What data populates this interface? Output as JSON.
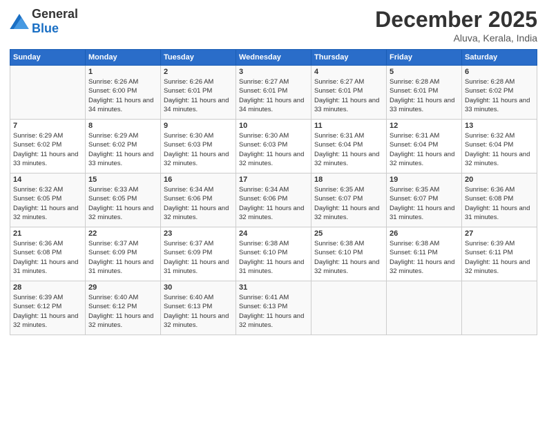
{
  "logo": {
    "general": "General",
    "blue": "Blue"
  },
  "title": "December 2025",
  "subtitle": "Aluva, Kerala, India",
  "headers": [
    "Sunday",
    "Monday",
    "Tuesday",
    "Wednesday",
    "Thursday",
    "Friday",
    "Saturday"
  ],
  "weeks": [
    [
      {
        "day": "",
        "sunrise": "",
        "sunset": "",
        "daylight": ""
      },
      {
        "day": "1",
        "sunrise": "Sunrise: 6:26 AM",
        "sunset": "Sunset: 6:00 PM",
        "daylight": "Daylight: 11 hours and 34 minutes."
      },
      {
        "day": "2",
        "sunrise": "Sunrise: 6:26 AM",
        "sunset": "Sunset: 6:01 PM",
        "daylight": "Daylight: 11 hours and 34 minutes."
      },
      {
        "day": "3",
        "sunrise": "Sunrise: 6:27 AM",
        "sunset": "Sunset: 6:01 PM",
        "daylight": "Daylight: 11 hours and 34 minutes."
      },
      {
        "day": "4",
        "sunrise": "Sunrise: 6:27 AM",
        "sunset": "Sunset: 6:01 PM",
        "daylight": "Daylight: 11 hours and 33 minutes."
      },
      {
        "day": "5",
        "sunrise": "Sunrise: 6:28 AM",
        "sunset": "Sunset: 6:01 PM",
        "daylight": "Daylight: 11 hours and 33 minutes."
      },
      {
        "day": "6",
        "sunrise": "Sunrise: 6:28 AM",
        "sunset": "Sunset: 6:02 PM",
        "daylight": "Daylight: 11 hours and 33 minutes."
      }
    ],
    [
      {
        "day": "7",
        "sunrise": "Sunrise: 6:29 AM",
        "sunset": "Sunset: 6:02 PM",
        "daylight": "Daylight: 11 hours and 33 minutes."
      },
      {
        "day": "8",
        "sunrise": "Sunrise: 6:29 AM",
        "sunset": "Sunset: 6:02 PM",
        "daylight": "Daylight: 11 hours and 33 minutes."
      },
      {
        "day": "9",
        "sunrise": "Sunrise: 6:30 AM",
        "sunset": "Sunset: 6:03 PM",
        "daylight": "Daylight: 11 hours and 32 minutes."
      },
      {
        "day": "10",
        "sunrise": "Sunrise: 6:30 AM",
        "sunset": "Sunset: 6:03 PM",
        "daylight": "Daylight: 11 hours and 32 minutes."
      },
      {
        "day": "11",
        "sunrise": "Sunrise: 6:31 AM",
        "sunset": "Sunset: 6:04 PM",
        "daylight": "Daylight: 11 hours and 32 minutes."
      },
      {
        "day": "12",
        "sunrise": "Sunrise: 6:31 AM",
        "sunset": "Sunset: 6:04 PM",
        "daylight": "Daylight: 11 hours and 32 minutes."
      },
      {
        "day": "13",
        "sunrise": "Sunrise: 6:32 AM",
        "sunset": "Sunset: 6:04 PM",
        "daylight": "Daylight: 11 hours and 32 minutes."
      }
    ],
    [
      {
        "day": "14",
        "sunrise": "Sunrise: 6:32 AM",
        "sunset": "Sunset: 6:05 PM",
        "daylight": "Daylight: 11 hours and 32 minutes."
      },
      {
        "day": "15",
        "sunrise": "Sunrise: 6:33 AM",
        "sunset": "Sunset: 6:05 PM",
        "daylight": "Daylight: 11 hours and 32 minutes."
      },
      {
        "day": "16",
        "sunrise": "Sunrise: 6:34 AM",
        "sunset": "Sunset: 6:06 PM",
        "daylight": "Daylight: 11 hours and 32 minutes."
      },
      {
        "day": "17",
        "sunrise": "Sunrise: 6:34 AM",
        "sunset": "Sunset: 6:06 PM",
        "daylight": "Daylight: 11 hours and 32 minutes."
      },
      {
        "day": "18",
        "sunrise": "Sunrise: 6:35 AM",
        "sunset": "Sunset: 6:07 PM",
        "daylight": "Daylight: 11 hours and 32 minutes."
      },
      {
        "day": "19",
        "sunrise": "Sunrise: 6:35 AM",
        "sunset": "Sunset: 6:07 PM",
        "daylight": "Daylight: 11 hours and 31 minutes."
      },
      {
        "day": "20",
        "sunrise": "Sunrise: 6:36 AM",
        "sunset": "Sunset: 6:08 PM",
        "daylight": "Daylight: 11 hours and 31 minutes."
      }
    ],
    [
      {
        "day": "21",
        "sunrise": "Sunrise: 6:36 AM",
        "sunset": "Sunset: 6:08 PM",
        "daylight": "Daylight: 11 hours and 31 minutes."
      },
      {
        "day": "22",
        "sunrise": "Sunrise: 6:37 AM",
        "sunset": "Sunset: 6:09 PM",
        "daylight": "Daylight: 11 hours and 31 minutes."
      },
      {
        "day": "23",
        "sunrise": "Sunrise: 6:37 AM",
        "sunset": "Sunset: 6:09 PM",
        "daylight": "Daylight: 11 hours and 31 minutes."
      },
      {
        "day": "24",
        "sunrise": "Sunrise: 6:38 AM",
        "sunset": "Sunset: 6:10 PM",
        "daylight": "Daylight: 11 hours and 31 minutes."
      },
      {
        "day": "25",
        "sunrise": "Sunrise: 6:38 AM",
        "sunset": "Sunset: 6:10 PM",
        "daylight": "Daylight: 11 hours and 32 minutes."
      },
      {
        "day": "26",
        "sunrise": "Sunrise: 6:38 AM",
        "sunset": "Sunset: 6:11 PM",
        "daylight": "Daylight: 11 hours and 32 minutes."
      },
      {
        "day": "27",
        "sunrise": "Sunrise: 6:39 AM",
        "sunset": "Sunset: 6:11 PM",
        "daylight": "Daylight: 11 hours and 32 minutes."
      }
    ],
    [
      {
        "day": "28",
        "sunrise": "Sunrise: 6:39 AM",
        "sunset": "Sunset: 6:12 PM",
        "daylight": "Daylight: 11 hours and 32 minutes."
      },
      {
        "day": "29",
        "sunrise": "Sunrise: 6:40 AM",
        "sunset": "Sunset: 6:12 PM",
        "daylight": "Daylight: 11 hours and 32 minutes."
      },
      {
        "day": "30",
        "sunrise": "Sunrise: 6:40 AM",
        "sunset": "Sunset: 6:13 PM",
        "daylight": "Daylight: 11 hours and 32 minutes."
      },
      {
        "day": "31",
        "sunrise": "Sunrise: 6:41 AM",
        "sunset": "Sunset: 6:13 PM",
        "daylight": "Daylight: 11 hours and 32 minutes."
      },
      {
        "day": "",
        "sunrise": "",
        "sunset": "",
        "daylight": ""
      },
      {
        "day": "",
        "sunrise": "",
        "sunset": "",
        "daylight": ""
      },
      {
        "day": "",
        "sunrise": "",
        "sunset": "",
        "daylight": ""
      }
    ]
  ]
}
